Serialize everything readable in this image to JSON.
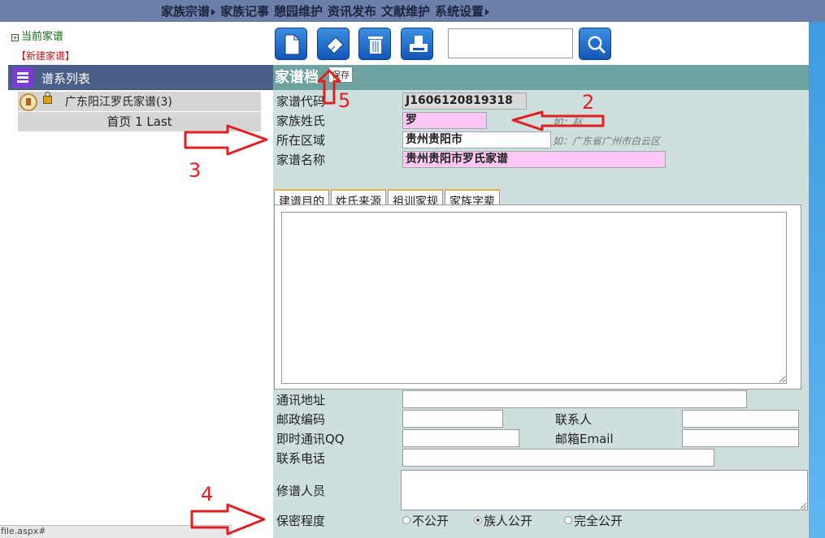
{
  "topnav": {
    "items": [
      "家族宗谱",
      "家族记事",
      "憩园维护",
      "资讯发布",
      "文献维护",
      "系统设置"
    ]
  },
  "sidebar": {
    "current_link": "当前家谱",
    "new_link": "【新建家谱】",
    "tree_header": "谱系列表",
    "tree_item": "广东阳江罗氏家谱(3)",
    "pager": "首页 1 Last"
  },
  "toolbar": {
    "buttons": [
      "new-document-icon",
      "save-eraser-icon",
      "trash-icon",
      "print-icon"
    ],
    "search_value": "",
    "tooltip": "保存"
  },
  "form": {
    "title": "家谱档",
    "code_label": "家谱代码",
    "code_value": "J1606120819318",
    "surname_label": "家族姓氏",
    "surname_value": "罗",
    "surname_hint": "如：赵",
    "region_label": "所在区域",
    "region_value": "贵州贵阳市",
    "region_hint": "如：广东省广州市白云区",
    "name_label": "家谱名称",
    "name_value": "贵州贵阳市罗氏家谱",
    "tabs": [
      "建谱目的",
      "姓氏来源",
      "祖训家规",
      "家族字辈"
    ],
    "address_label": "通讯地址",
    "postal_label": "邮政编码",
    "contact_label": "联系人",
    "qq_label": "即时通讯QQ",
    "email_label": "邮箱Email",
    "phone_label": "联系电话",
    "editors_label": "修谱人员",
    "privacy_label": "保密程度",
    "privacy_options": [
      "不公开",
      "族人公开",
      "完全公开"
    ],
    "privacy_selected": "族人公开"
  },
  "annotations": [
    "2",
    "3",
    "4",
    "5"
  ],
  "status_bar": "file.aspx#",
  "colors": {
    "nav_bg": "#6b7fa8",
    "panel_bg": "#cfdfdf",
    "panel_title_bg": "#6ea3a1",
    "pink_field": "#ffc7f3",
    "annotation_red": "#e02020",
    "button_blue": "#1e6fcf"
  }
}
